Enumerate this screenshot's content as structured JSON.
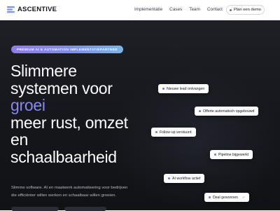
{
  "brand": {
    "name": "ASCENTIVE"
  },
  "nav": {
    "items": [
      "Implementatie",
      "Cases",
      "Team",
      "Contact"
    ],
    "cta": "Plan een demo"
  },
  "hero": {
    "badge": "PREMIUM AI & AUTOMATION IMPLEMENTATIEPARTNER",
    "headline": {
      "line1": "Slimmere",
      "line2": "systemen voor",
      "accent": "groei",
      "line4": "meer rust, omzet",
      "line5": "en",
      "line6": "schaalbaarheid"
    },
    "subtext": {
      "line1": "Slimme software. AI en maatwerk automatisering voor bedrijven",
      "line2": "die efficiënter willen werken en schaalbaar willen groeien."
    }
  },
  "cards": [
    {
      "label": "Nieuwe lead ontvangen"
    },
    {
      "label": "Offerte automatisch opgebouwd"
    },
    {
      "label": "Follow-up verstuurd"
    },
    {
      "label": "Pipeline bijgewerkt"
    },
    {
      "label": "AI workflow actief"
    },
    {
      "label": "Deal gewonnen",
      "check": "✓"
    }
  ],
  "colors": {
    "hero_bg": "#1a1b21",
    "accent_gradient_start": "#8f7bf1",
    "accent_gradient_end": "#79b6ea"
  },
  "icons": {
    "logo": "logo-mark-icon",
    "card": "status-dot-icon",
    "demo": "dot-icon"
  }
}
